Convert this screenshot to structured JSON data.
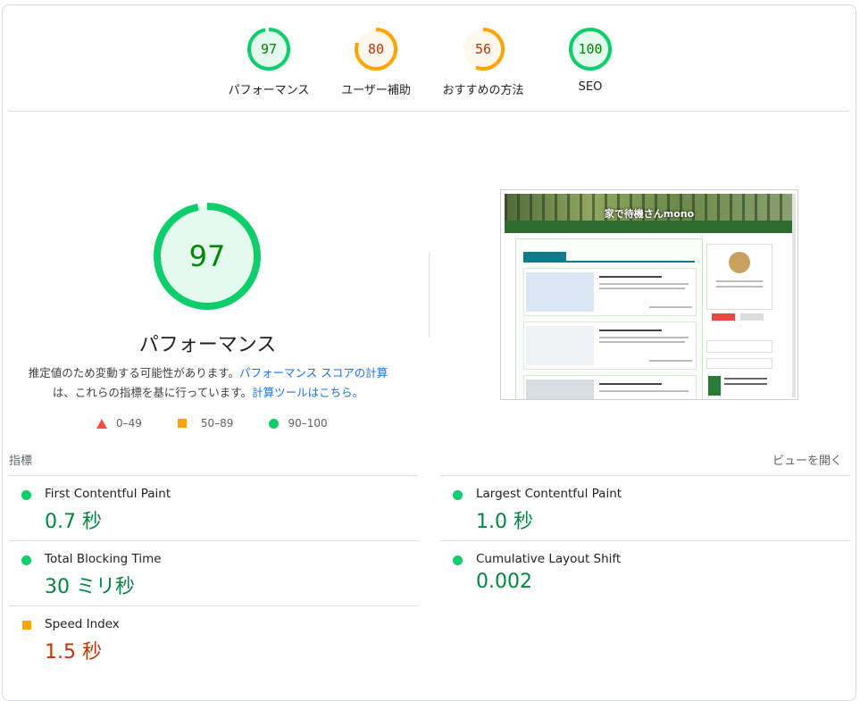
{
  "categories": [
    {
      "id": "performance",
      "score": "97",
      "label": "パフォーマンス",
      "rating": "pass",
      "color": "#0cce6b",
      "text_color": "#008800",
      "bg": "#e5faef",
      "fraction": 0.97
    },
    {
      "id": "accessibility",
      "score": "80",
      "label": "ユーザー補助",
      "rating": "average",
      "color": "#ffa400",
      "text_color": "#c33300",
      "bg": "#fff8ec",
      "fraction": 0.8
    },
    {
      "id": "best-practices",
      "score": "56",
      "label": "おすすめの方法",
      "rating": "average",
      "color": "#ffa400",
      "text_color": "#c33300",
      "bg": "#fff8ec",
      "fraction": 0.56
    },
    {
      "id": "seo",
      "score": "100",
      "label": "SEO",
      "rating": "pass",
      "color": "#0cce6b",
      "text_color": "#008800",
      "bg": "#e5faef",
      "fraction": 1.0
    }
  ],
  "main": {
    "score": "97",
    "fraction": 0.97,
    "title": "パフォーマンス",
    "desc_1": "推定値のため変動する可能性があります。",
    "desc_link_1": "パフォーマンス スコアの計算",
    "desc_2": "は、これらの指標を基に行っています。",
    "desc_link_2": "計算ツールはこちら。"
  },
  "legend": [
    {
      "range": "0–49",
      "shape": "triangle-icon",
      "color": "#ff4e42"
    },
    {
      "range": "50–89",
      "shape": "square-icon",
      "color": "#ffa400"
    },
    {
      "range": "90–100",
      "shape": "circle-icon",
      "color": "#0cce6b"
    }
  ],
  "screenshot": {
    "site_title": "家で待機さんmono"
  },
  "metrics": {
    "header": "指標",
    "view_toggle": "ビューを開く",
    "items": [
      {
        "name": "First Contentful Paint",
        "value": "0.7 秒",
        "rating": "pass"
      },
      {
        "name": "Largest Contentful Paint",
        "value": "1.0 秒",
        "rating": "pass"
      },
      {
        "name": "Total Blocking Time",
        "value": "30 ミリ秒",
        "rating": "pass"
      },
      {
        "name": "Cumulative Layout Shift",
        "value": "0.002",
        "rating": "pass"
      },
      {
        "name": "Speed Index",
        "value": "1.5 秒",
        "rating": "average"
      }
    ]
  },
  "colors": {
    "pass": "#0cce6b",
    "average": "#ffa400",
    "fail": "#ff4e42",
    "link": "#1a73e8"
  }
}
